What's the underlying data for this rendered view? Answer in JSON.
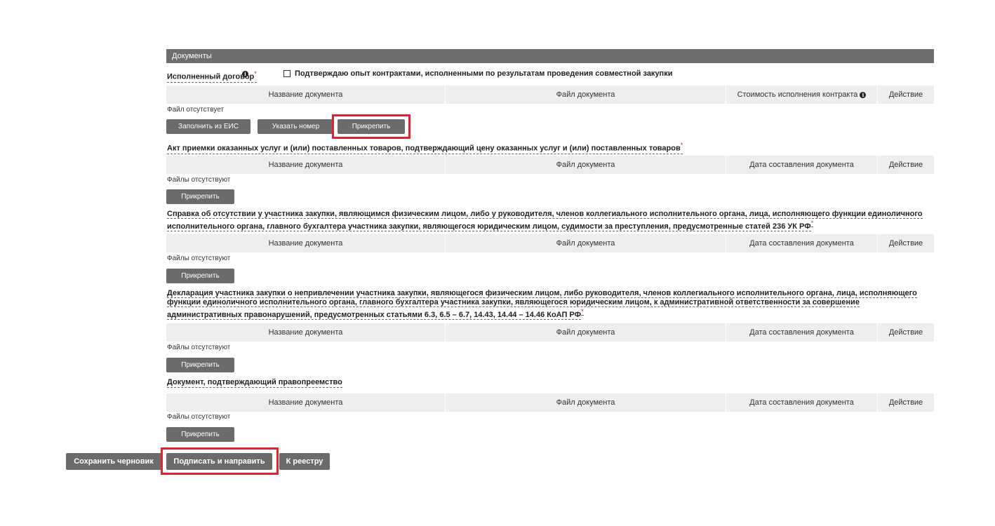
{
  "section": {
    "title": "Документы"
  },
  "contract": {
    "label": "Исполненный договор",
    "checkbox_label": "Подтверждаю опыт контрактами, исполненными по результатам проведения совместной закупки",
    "columns": [
      "Название документа",
      "Файл документа",
      "Стоимость исполнения контракта",
      "Действие"
    ],
    "empty_text": "Файл отсутствует",
    "buttons": {
      "fill_eis": "Заполнить из ЕИС",
      "specify_number": "Указать номер",
      "attach": "Прикрепить"
    }
  },
  "sections": [
    {
      "label": "Акт приемки оказанных услуг и (или) поставленных товаров, подтверждающий цену оказанных услуг и (или) поставленных товаров",
      "columns": [
        "Название документа",
        "Файл документа",
        "Дата составления документа",
        "Действие"
      ],
      "empty_text": "Файлы отсутствуют",
      "attach": "Прикрепить"
    },
    {
      "label": "Справка об отсутствии у участника закупки, являющимся физическим лицом, либо у руководителя, членов коллегиального исполнительного органа, лица, исполняющего функции единоличного исполнительного органа, главного бухгалтера участника закупки, являющегося юридическим лицом, судимости за преступления, предусмотренные статей 236 УК РФ",
      "columns": [
        "Название документа",
        "Файл документа",
        "Дата составления документа",
        "Действие"
      ],
      "empty_text": "Файлы отсутствуют",
      "attach": "Прикрепить"
    },
    {
      "label": "Декларация участника закупки о непривлечении участника закупки, являющегося физическим лицом, либо руководителя, членов коллегиального исполнительного органа, лица, исполняющего функции единоличного исполнительного органа, главного бухгалтера участника закупки, являющегося юридическим лицом, к административной ответственности за совершение административных правонарушений, предусмотренных статьями 6.3, 6.5 – 6.7, 14.43, 14.44 – 14.46 КоАП РФ",
      "columns": [
        "Название документа",
        "Файл документа",
        "Дата составления документа",
        "Действие"
      ],
      "empty_text": "Файлы отсутствуют",
      "attach": "Прикрепить"
    },
    {
      "label": "Документ, подтверждающий правопреемство",
      "columns": [
        "Название документа",
        "Файл документа",
        "Дата составления документа",
        "Действие"
      ],
      "empty_text": "Файлы отсутствуют",
      "attach": "Прикрепить"
    }
  ],
  "footer": {
    "save_draft": "Сохранить черновик",
    "sign_send": "Подписать и направить",
    "to_registry": "К реестру"
  },
  "colors": {
    "button": "#6b6b6b",
    "header": "#6d6d6d",
    "highlight": "#e0232e",
    "table_head": "#eeeeee"
  },
  "icons": {
    "info": "info-icon"
  }
}
